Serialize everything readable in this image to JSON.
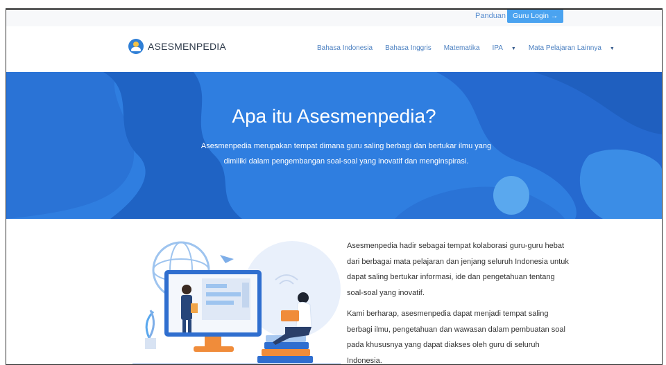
{
  "topbar": {
    "guide_label": "Panduan",
    "login_label": "Guru Login →"
  },
  "brand": {
    "name": "ASESMENPEDIA",
    "logo_icon": "tut-wuri-handayani-logo"
  },
  "nav": {
    "items": [
      {
        "label": "Bahasa Indonesia",
        "dropdown": false
      },
      {
        "label": "Bahasa Inggris",
        "dropdown": false
      },
      {
        "label": "Matematika",
        "dropdown": false
      },
      {
        "label": "IPA",
        "dropdown": true
      },
      {
        "label": "Mata Pelajaran Lainnya",
        "dropdown": true
      }
    ],
    "caret_glyph": "▼"
  },
  "hero": {
    "title": "Apa itu Asesmenpedia?",
    "line1": "Asesmenpedia merupakan tempat dimana guru saling berbagi dan bertukar ilmu yang",
    "line2": "dimiliki dalam pengembangan soal-soal yang inovatif dan menginspirasi."
  },
  "about": {
    "para1": "Asesmenpedia hadir sebagai tempat kolaborasi guru-guru hebat dari berbagai mata pelajaran dan jenjang seluruh Indonesia untuk dapat saling bertukar informasi, ide dan pengetahuan tentang soal-soal yang inovatif.",
    "para2": "Kami berharap, asesmenpedia dapat menjadi tempat saling berbagi ilmu, pengetahuan dan wawasan dalam pembuatan soal pada khususnya yang dapat diakses oleh guru di seluruh Indonesia."
  },
  "colors": {
    "hero_bg": "#2f7ee0",
    "hero_shape": "#1f63c4",
    "nav_link": "#4a7fc0",
    "login_button": "#4aa3f0"
  }
}
